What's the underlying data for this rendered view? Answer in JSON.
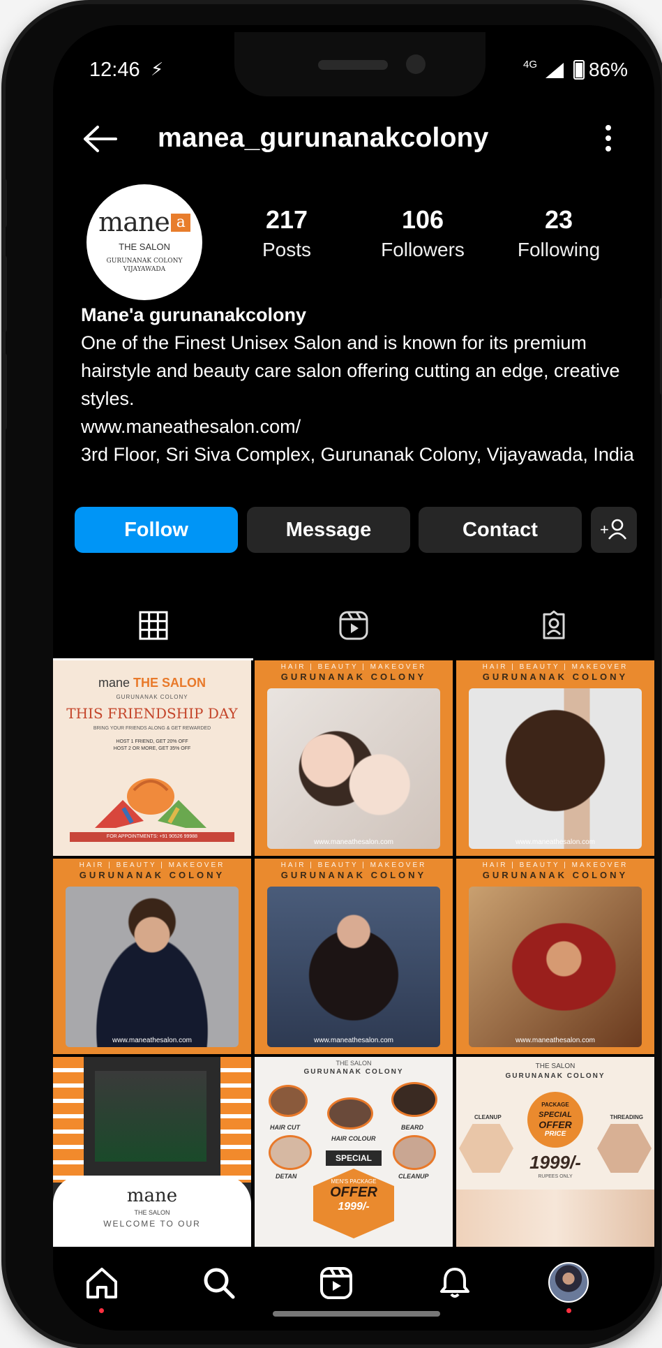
{
  "status": {
    "time": "12:46",
    "network": "4G",
    "battery": "86%",
    "battery_level": 0.86
  },
  "header": {
    "username": "manea_gurunanakcolony",
    "back_icon": "back-arrow-icon",
    "menu_icon": "more-vertical-icon"
  },
  "avatar": {
    "logo_text": "mane",
    "logo_mark": "a",
    "salon_text": "THE SALON",
    "location_line1": "GURUNANAK COLONY",
    "location_line2": "VIJAYAWADA"
  },
  "stats": {
    "posts": {
      "value": "217",
      "label": "Posts"
    },
    "followers": {
      "value": "106",
      "label": "Followers"
    },
    "following": {
      "value": "23",
      "label": "Following"
    }
  },
  "bio": {
    "name": "Mane'a gurunanakcolony",
    "description": "One of the Finest Unisex Salon and is known for its premium hairstyle and beauty care salon offering cutting an edge, creative styles.",
    "website": "www.maneathesalon.com/",
    "address": "3rd Floor, Sri Siva Complex, Gurunanak Colony, Vijayawada, India"
  },
  "actions": {
    "follow": "Follow",
    "message": "Message",
    "contact": "Contact",
    "add_user_icon": "add-person-icon"
  },
  "tabs": [
    {
      "icon": "grid-icon",
      "active": true
    },
    {
      "icon": "reels-icon",
      "active": false
    },
    {
      "icon": "tagged-icon",
      "active": false
    }
  ],
  "posts": {
    "band_line1": "HAIR | BEAUTY | MAKEOVER",
    "band_line2": "GURUNANAK COLONY",
    "url": "www.maneathesalon.com",
    "promo": {
      "brand_a": "mane",
      "brand_b": "THE SALON",
      "sub": "GURUNANAK COLONY",
      "headline": "THIS FRIENDSHIP DAY",
      "tag": "BRING YOUR FRIENDS ALONG & GET REWARDED",
      "offer1": "HOST 1 FRIEND, GET 20% OFF",
      "offer2": "HOST 2 OR MORE, GET 35% OFF",
      "appointment": "FOR APPOINTMENTS: +91 90526 99988"
    },
    "salon_welcome": {
      "brand": "mane",
      "salon": "THE SALON",
      "line": "WELCOME TO OUR"
    },
    "services": {
      "salon": "THE SALON",
      "colony": "GURUNANAK COLONY",
      "items": [
        "HAIR CUT",
        "HAIR COLOUR",
        "BEARD",
        "DETAN",
        "CLEANUP"
      ],
      "special": "SPECIAL",
      "package": "MEN'S PACKAGE",
      "offer": "OFFER",
      "price": "1999/-"
    },
    "package": {
      "salon": "THE SALON",
      "colony": "GURUNANAK COLONY",
      "left": "CLEANUP",
      "right": "THREADING",
      "badge1": "PACKAGE",
      "badge2": "SPECIAL",
      "badge3": "OFFER",
      "badge4": "PRICE",
      "price": "1999/-",
      "price_note": "RUPEES ONLY"
    }
  },
  "colors": {
    "follow": "#0095f6",
    "band": "#ea8a2e",
    "notification_dot": "#ff3040"
  }
}
